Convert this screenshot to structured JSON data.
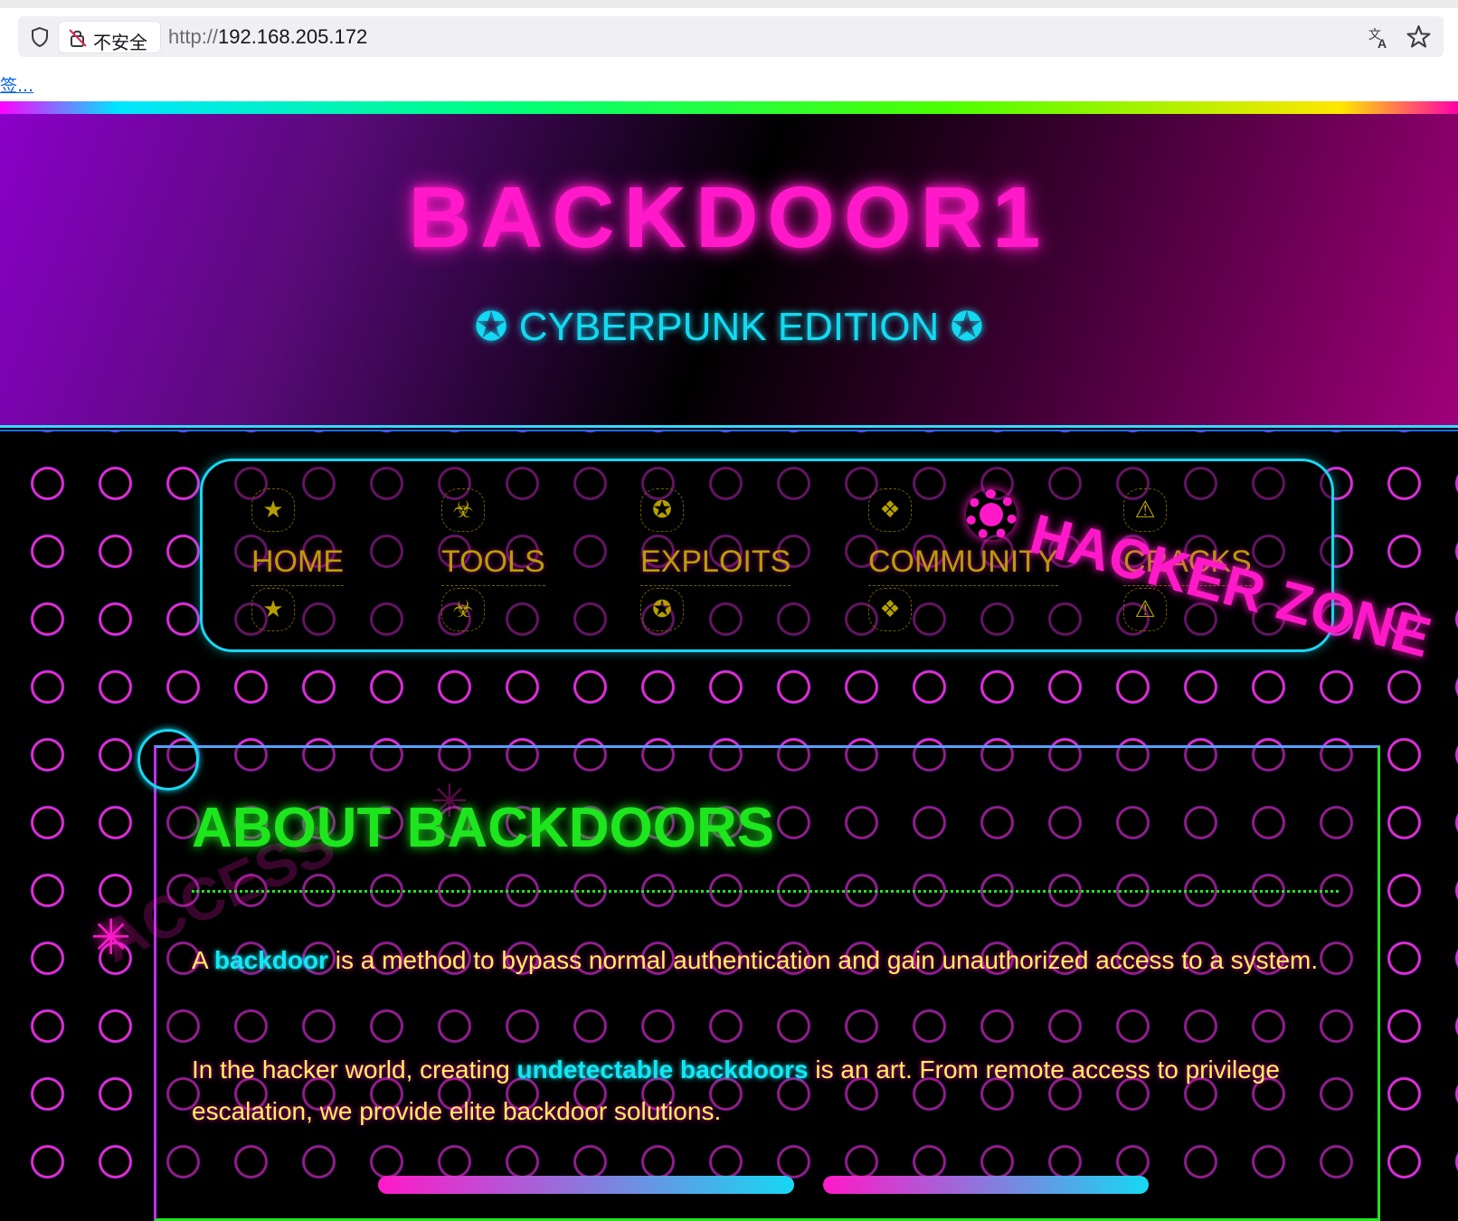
{
  "browser": {
    "security_label": "不安全",
    "url_protocol": "http://",
    "url_host": "192.168.205.172",
    "bookmark_label": "签..."
  },
  "header": {
    "title": "BACKDOOR1",
    "subtitle": "✪ CYBERPUNK EDITION ✪"
  },
  "nav": {
    "items": [
      {
        "label": "HOME",
        "icon": "★"
      },
      {
        "label": "TOOLS",
        "icon": "☣"
      },
      {
        "label": "EXPLOITS",
        "icon": "✪"
      },
      {
        "label": "COMMUNITY",
        "icon": "❖"
      },
      {
        "label": "CRACKS",
        "icon": "⚠"
      }
    ]
  },
  "decor": {
    "hacker_zone": "HACKER ZONE",
    "access": "ACCESS",
    "access_star": "✳"
  },
  "about": {
    "title": "ABOUT BACKDOORS",
    "p1_a": "A ",
    "p1_hl": "backdoor",
    "p1_b": " is a method to bypass normal authentication and gain unauthorized access to a system.",
    "p2_a": "In the hacker world, creating ",
    "p2_hl": "undetectable backdoors",
    "p2_b": " is an art. From remote access to privilege escalation, we provide elite backdoor solutions."
  },
  "colors": {
    "neon_pink": "#ff19c8",
    "neon_cyan": "#16d8f2",
    "neon_green": "#1ee61e",
    "text_yellow": "#fff25a"
  }
}
